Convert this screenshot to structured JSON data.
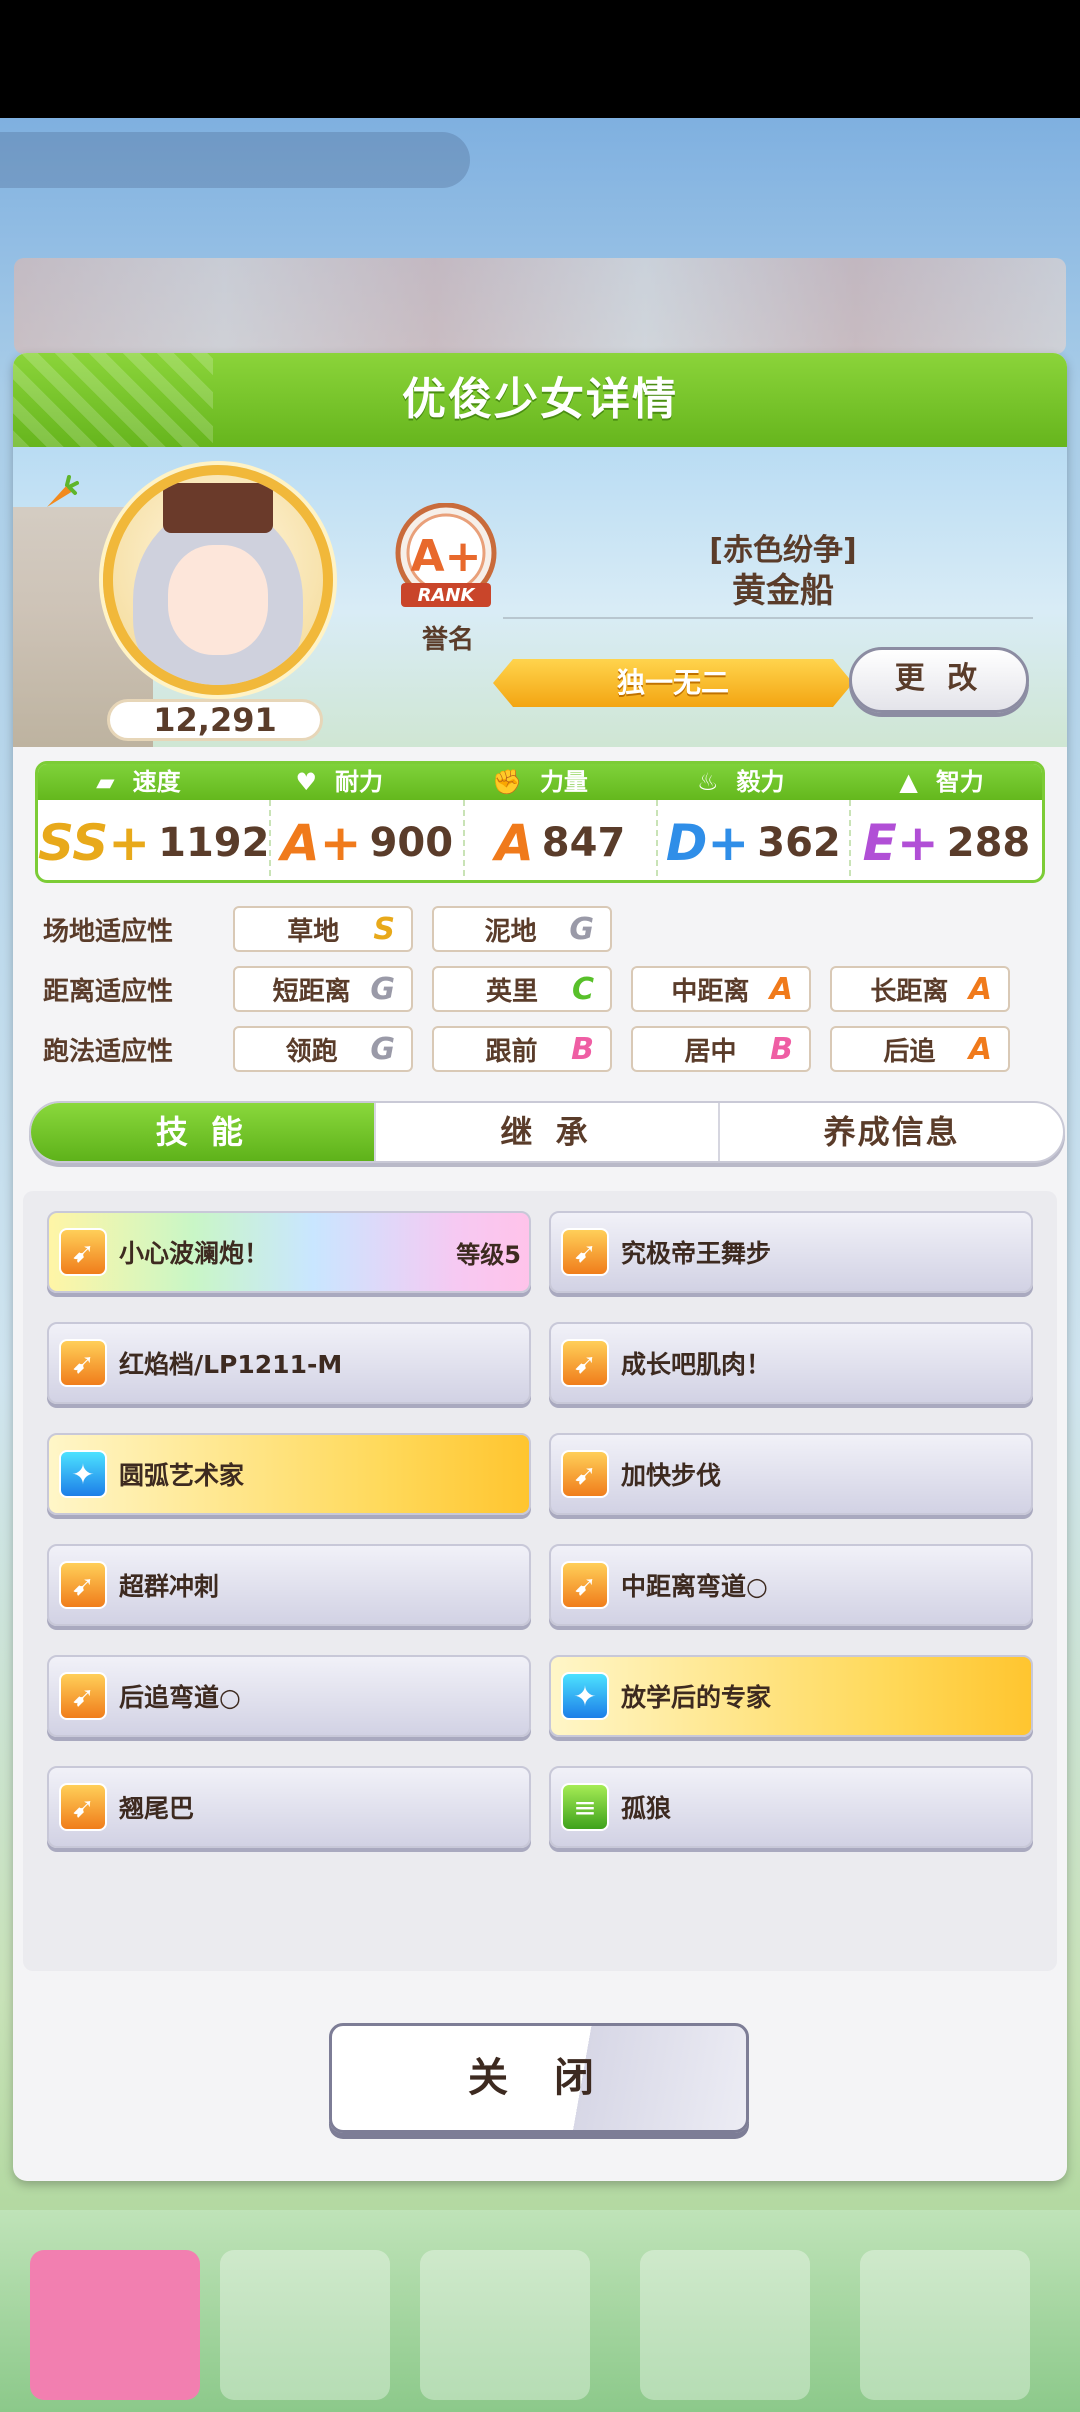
{
  "panel": {
    "title": "优俊少女详情"
  },
  "profile": {
    "fans": "12,291",
    "rank": {
      "grade": "A+",
      "word": "RANK",
      "label": "誉名"
    },
    "epithet": "[赤色纷争]",
    "name": "黄金船",
    "title": "独一无二",
    "change_label": "更 改"
  },
  "stats": [
    {
      "label": "速度",
      "icon": "shoe-icon",
      "grade": "SS+",
      "value": "1192",
      "color": "#e8a91a"
    },
    {
      "label": "耐力",
      "icon": "heart-icon",
      "grade": "A+",
      "value": "900",
      "color": "#f07a1b"
    },
    {
      "label": "力量",
      "icon": "arm-icon",
      "grade": "A",
      "value": "847",
      "color": "#f07a1b"
    },
    {
      "label": "毅力",
      "icon": "flame-icon",
      "grade": "D+",
      "value": "362",
      "color": "#2f8ee8"
    },
    {
      "label": "智力",
      "icon": "mortarboard-icon",
      "grade": "E+",
      "value": "288",
      "color": "#b14fd6"
    }
  ],
  "aptitude": {
    "track": {
      "label": "场地适应性",
      "items": [
        {
          "name": "草地",
          "grade": "S",
          "color": "#e8a91a"
        },
        {
          "name": "泥地",
          "grade": "G",
          "color": "#9a9aa8"
        }
      ]
    },
    "distance": {
      "label": "距离适应性",
      "items": [
        {
          "name": "短距离",
          "grade": "G",
          "color": "#9a9aa8"
        },
        {
          "name": "英里",
          "grade": "C",
          "color": "#58c02a"
        },
        {
          "name": "中距离",
          "grade": "A",
          "color": "#f07a1b"
        },
        {
          "name": "长距离",
          "grade": "A",
          "color": "#f07a1b"
        }
      ]
    },
    "strategy": {
      "label": "跑法适应性",
      "items": [
        {
          "name": "领跑",
          "grade": "G",
          "color": "#9a9aa8"
        },
        {
          "name": "跟前",
          "grade": "B",
          "color": "#ef5ea4"
        },
        {
          "name": "居中",
          "grade": "B",
          "color": "#ef5ea4"
        },
        {
          "name": "后追",
          "grade": "A",
          "color": "#f07a1b"
        }
      ]
    }
  },
  "tabs": [
    {
      "label": "技 能",
      "active": true
    },
    {
      "label": "继 承",
      "active": false
    },
    {
      "label": "养成信息",
      "active": false
    }
  ],
  "skills": [
    {
      "name": "小心波澜炮！",
      "level": "等级5",
      "style": "rainbow",
      "icon": "orange"
    },
    {
      "name": "究极帝王舞步",
      "level": "",
      "style": "normal",
      "icon": "orange"
    },
    {
      "name": "红焰档/LP1211-M",
      "level": "",
      "style": "normal",
      "icon": "orange"
    },
    {
      "name": "成长吧肌肉！",
      "level": "",
      "style": "normal",
      "icon": "orange"
    },
    {
      "name": "圆弧艺术家",
      "level": "",
      "style": "gold",
      "icon": "blue"
    },
    {
      "name": "加快步伐",
      "level": "",
      "style": "normal",
      "icon": "orange"
    },
    {
      "name": "超群冲刺",
      "level": "",
      "style": "normal",
      "icon": "orange"
    },
    {
      "name": "中距离弯道○",
      "level": "",
      "style": "normal",
      "icon": "orange"
    },
    {
      "name": "后追弯道○",
      "level": "",
      "style": "normal",
      "icon": "orange"
    },
    {
      "name": "放学后的专家",
      "level": "",
      "style": "gold",
      "icon": "blue"
    },
    {
      "name": "翘尾巴",
      "level": "",
      "style": "normal",
      "icon": "orange"
    },
    {
      "name": "孤狼",
      "level": "",
      "style": "normal",
      "icon": "green"
    }
  ],
  "close_label": "关 闭"
}
